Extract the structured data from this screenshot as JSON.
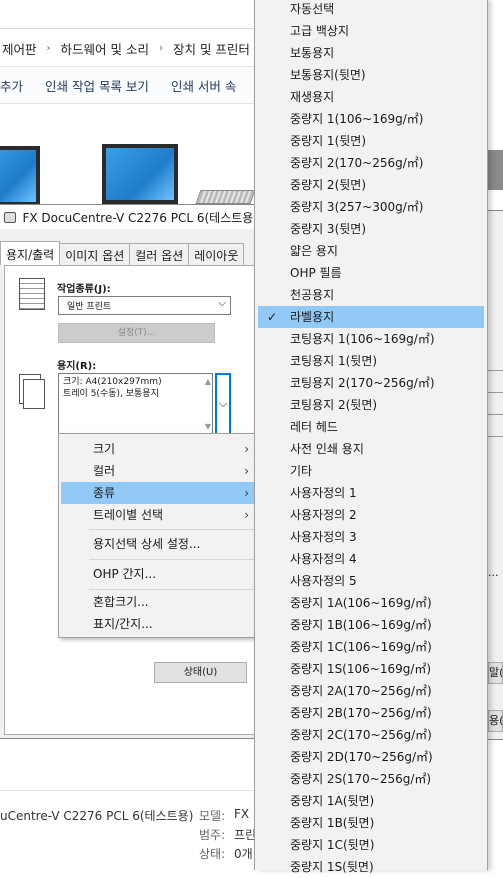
{
  "breadcrumb": {
    "items": [
      "제어판",
      "하드웨어 및 소리",
      "장치 및 프린터"
    ]
  },
  "command_bar": {
    "items": [
      "추가",
      "인쇄 작업 목록 보기",
      "인쇄 서버 속"
    ]
  },
  "dialog": {
    "title": "FX DocuCentre-V C2276 PCL 6(테스트용)",
    "tabs": [
      "용지/출력",
      "이미지 옵션",
      "컬러 옵션",
      "레이아웃"
    ],
    "job_type_label": "작업종류(J):",
    "job_type_value": "일반 프린트",
    "settings_button": "설정(T)...",
    "paper_label": "용지(R):",
    "paper_info": [
      "크기: A4(210x297mm)",
      "트레이 5(수동), 보통용지"
    ],
    "status_button": "상태(U)"
  },
  "context_menu": {
    "items": [
      {
        "label": "크기",
        "submenu": true
      },
      {
        "label": "컬러",
        "submenu": true
      },
      {
        "label": "종류",
        "submenu": true,
        "highlighted": true
      },
      {
        "label": "트레이별 선택",
        "submenu": true
      },
      {
        "label": "용지선택 상세 설정...",
        "submenu": false
      },
      {
        "label": "OHP 간지...",
        "submenu": false
      },
      {
        "label": "혼합크기...",
        "submenu": false
      },
      {
        "label": "표지/간지...",
        "submenu": false
      }
    ]
  },
  "paper_type_menu": {
    "items": [
      "자동선택",
      "고급 백상지",
      "보통용지",
      "보통용지(뒷면)",
      "재생용지",
      "중량지 1(106~169g/㎡)",
      "중량지 1(뒷면)",
      "중량지 2(170~256g/㎡)",
      "중량지 2(뒷면)",
      "중량지 3(257~300g/㎡)",
      "중량지 3(뒷면)",
      "얇은 용지",
      "OHP 필름",
      "천공용지",
      "라벨용지",
      "코팅용지 1(106~169g/㎡)",
      "코팅용지 1(뒷면)",
      "코팅용지 2(170~256g/㎡)",
      "코팅용지 2(뒷면)",
      "레터 헤드",
      "사전 인쇄 용지",
      "기타",
      "사용자정의 1",
      "사용자정의 2",
      "사용자정의 3",
      "사용자정의 4",
      "사용자정의 5",
      "중량지 1A(106~169g/㎡)",
      "중량지 1B(106~169g/㎡)",
      "중량지 1C(106~169g/㎡)",
      "중량지 1S(106~169g/㎡)",
      "중량지 2A(170~256g/㎡)",
      "중량지 2B(170~256g/㎡)",
      "중량지 2C(170~256g/㎡)",
      "중량지 2D(170~256g/㎡)",
      "중량지 2S(170~256g/㎡)",
      "중량지 1A(뒷면)",
      "중량지 1B(뒷면)",
      "중량지 1C(뒷면)",
      "중량지 1S(뒷면)"
    ],
    "checked": "라벨용지"
  },
  "status_panel": {
    "device_name": "uCentre-V C2276 PCL 6(테스트용)",
    "model_label": "모델:",
    "model_value": "FX I",
    "category_label": "범주:",
    "category_value": "프린",
    "state_label": "상태:",
    "state_value": "0개"
  },
  "right_edge": {
    "text1": "말(H",
    "text2": "용("
  },
  "colors": {
    "highlight": "#91c9f7",
    "menu_bg": "#f2f2f2",
    "accent": "#1e395b"
  }
}
